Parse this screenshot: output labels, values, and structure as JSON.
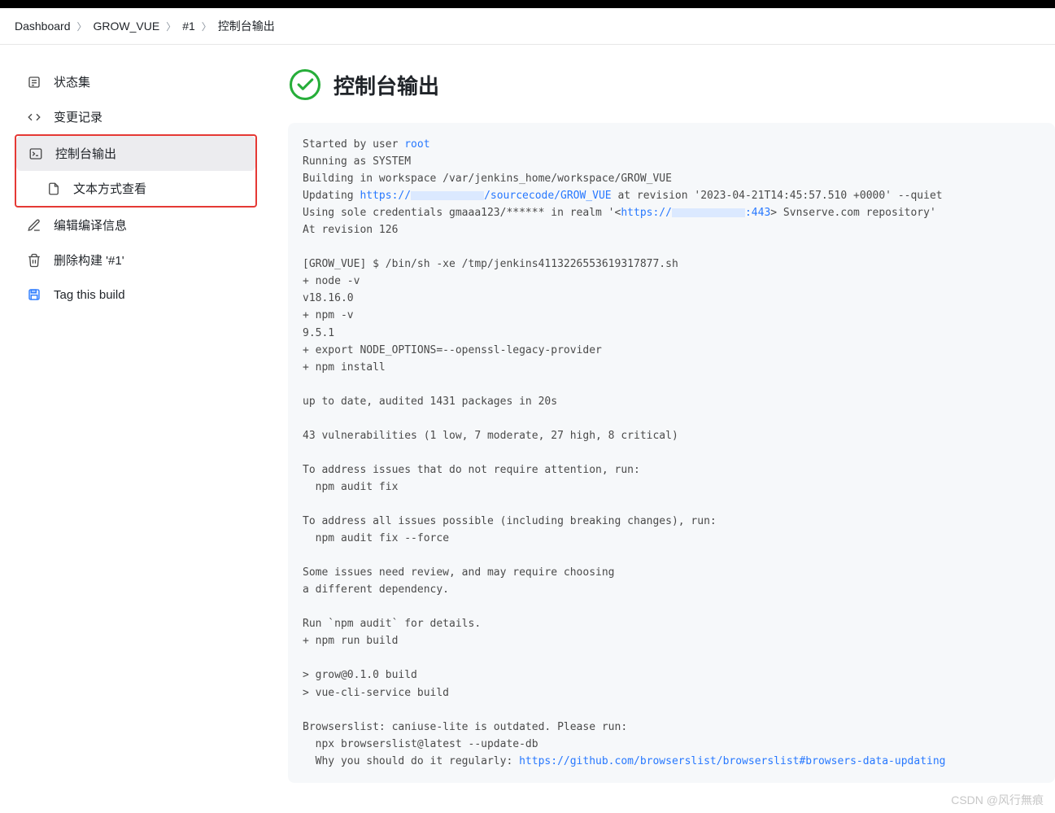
{
  "breadcrumb": {
    "items": [
      {
        "label": "Dashboard"
      },
      {
        "label": "GROW_VUE"
      },
      {
        "label": "#1"
      },
      {
        "label": "控制台输出"
      }
    ]
  },
  "sidebar": {
    "items": [
      {
        "label": "状态集"
      },
      {
        "label": "变更记录"
      },
      {
        "label": "控制台输出"
      },
      {
        "label": "文本方式查看"
      },
      {
        "label": "编辑编译信息"
      },
      {
        "label": "删除构建 '#1'"
      },
      {
        "label": "Tag this build"
      }
    ]
  },
  "header": {
    "title": "控制台输出"
  },
  "console": {
    "lines": {
      "l0a": "Started by user ",
      "l0b_link": "root",
      "l1": "Running as SYSTEM",
      "l2": "Building in workspace /var/jenkins_home/workspace/GROW_VUE",
      "l3a": "Updating ",
      "l3b_link": "https://",
      "l3c_link": "/sourcecode/GROW_VUE",
      "l3d": " at revision '2023-04-21T14:45:57.510 +0000' --quiet",
      "l4a": "Using sole credentials gmaaa123/****** in realm '<",
      "l4b_link": "https://",
      "l4c_link": ":443",
      "l4d": "> Svnserve.com repository'",
      "l5": "At revision 126",
      "l6": "",
      "l7": "[GROW_VUE] $ /bin/sh -xe /tmp/jenkins4113226553619317877.sh",
      "l8": "+ node -v",
      "l9": "v18.16.0",
      "l10": "+ npm -v",
      "l11": "9.5.1",
      "l12": "+ export NODE_OPTIONS=--openssl-legacy-provider",
      "l13": "+ npm install",
      "l14": "",
      "l15": "up to date, audited 1431 packages in 20s",
      "l16": "",
      "l17": "43 vulnerabilities (1 low, 7 moderate, 27 high, 8 critical)",
      "l18": "",
      "l19": "To address issues that do not require attention, run:",
      "l20": "  npm audit fix",
      "l21": "",
      "l22": "To address all issues possible (including breaking changes), run:",
      "l23": "  npm audit fix --force",
      "l24": "",
      "l25": "Some issues need review, and may require choosing",
      "l26": "a different dependency.",
      "l27": "",
      "l28": "Run `npm audit` for details.",
      "l29": "+ npm run build",
      "l30": "",
      "l31": "> grow@0.1.0 build",
      "l32": "> vue-cli-service build",
      "l33": "",
      "l34": "Browserslist: caniuse-lite is outdated. Please run:",
      "l35": "  npx browserslist@latest --update-db",
      "l36a": "  Why you should do it regularly: ",
      "l36b_link": "https://github.com/browserslist/browserslist#browsers-data-updating"
    }
  },
  "watermark": "CSDN @风行無痕"
}
